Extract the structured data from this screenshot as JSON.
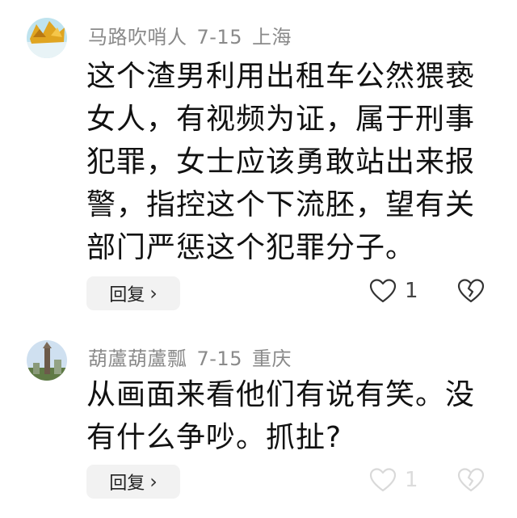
{
  "comments": [
    {
      "username": "马路吹哨人",
      "date": "7-15",
      "location": "上海",
      "text": "这个渣男利用出租车公然猥亵女人，有视频为证，属于刑事犯罪，女士应该勇敢站出来报警，指控这个下流胚，望有关部门严惩这个犯罪分子。",
      "reply_label": "回复",
      "like_count": "1"
    },
    {
      "username": "葫蘆葫蘆瓢",
      "date": "7-15",
      "location": "重庆",
      "text": "从画面来看他们有说有笑。没有什么争吵。抓扯?",
      "reply_label": "回复",
      "like_count": "1"
    }
  ]
}
